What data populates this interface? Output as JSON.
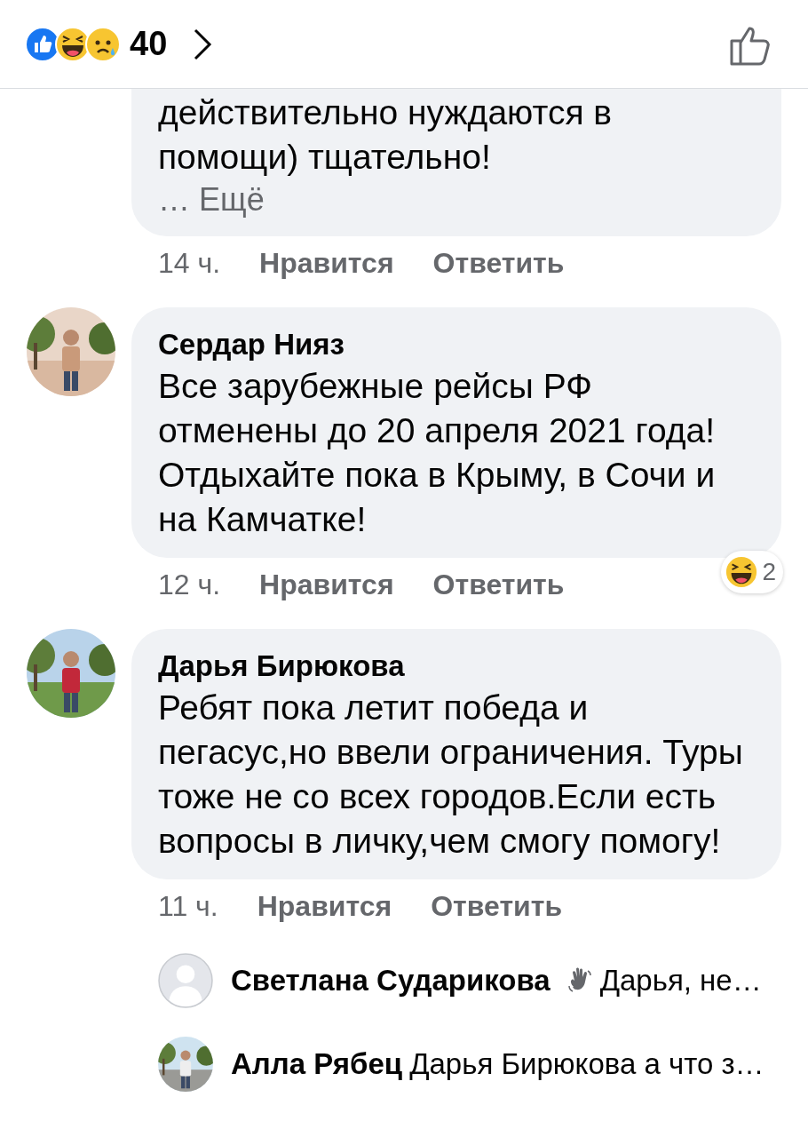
{
  "header": {
    "reactions": [
      {
        "kind": "like"
      },
      {
        "kind": "haha"
      },
      {
        "kind": "sad"
      }
    ],
    "count": "40"
  },
  "comments": [
    {
      "text": "действительно нуждаются в помощи) тщательно!",
      "more": "… Ещё",
      "time": "14 ч.",
      "like": "Нравится",
      "reply": "Ответить"
    },
    {
      "author": "Сердар Нияз",
      "avatar": {
        "kind": "picture"
      },
      "text": "Все зарубежные рейсы РФ отменены до 20 апреля 2021 года! Отдыхайте пока в Крыму, в Сочи и на Камчатке!",
      "time": "12 ч.",
      "like": "Нравится",
      "reply": "Ответить",
      "reaction": {
        "kind": "haha",
        "count": "2"
      }
    },
    {
      "author": "Дарья Бирюкова",
      "avatar": {
        "kind": "picture"
      },
      "text": "Ребят пока летит победа и пегасус,но ввели ограничения. Туры тоже не со всех городов.Если есть вопросы в личку,чем смогу помогу!",
      "time": "11 ч.",
      "like": "Нравится",
      "reply": "Ответить",
      "replies": [
        {
          "author": "Светлана Сударикова",
          "avatar": {
            "kind": "default"
          },
          "lead_icon": {
            "kind": "wave"
          },
          "text": "Дарья, не…"
        },
        {
          "author": "Алла Рябец",
          "avatar": {
            "kind": "picture"
          },
          "text": "Дарья Бирюкова а что з…"
        }
      ]
    }
  ]
}
